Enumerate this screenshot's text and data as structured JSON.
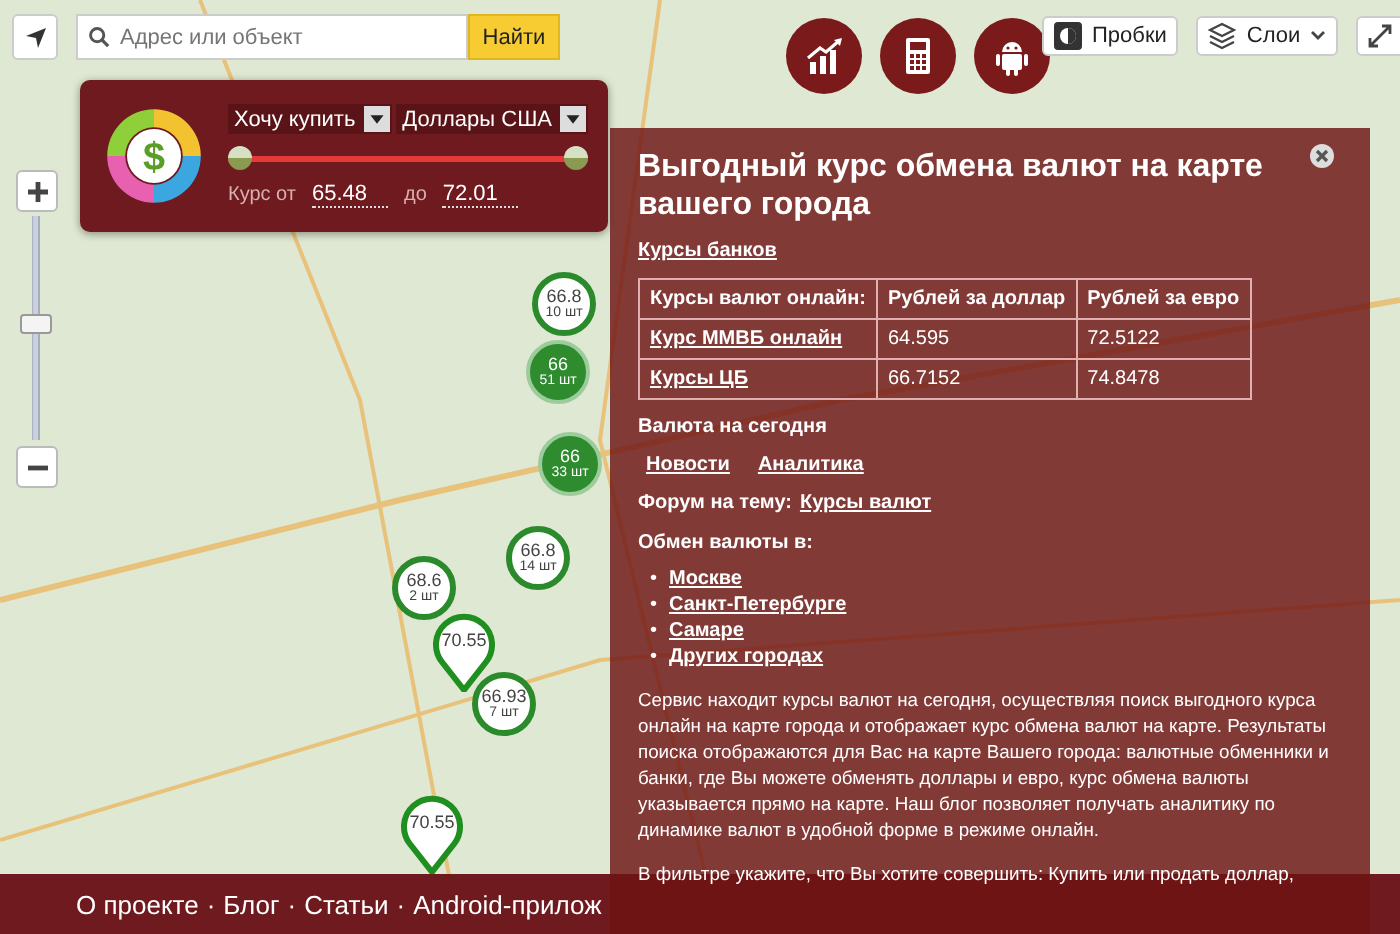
{
  "search": {
    "placeholder": "Адрес или объект",
    "button": "Найти"
  },
  "zoom": {
    "level": 0.52
  },
  "filter": {
    "logo_symbol": "$",
    "action": "Хочу купить",
    "currency": "Доллары США",
    "range_low": {
      "level": 0
    },
    "range_high": {
      "level": 1
    },
    "rate_from_label": "Курс от",
    "rate_from": "65.48",
    "rate_to_label": "до",
    "rate_to": "72.01"
  },
  "toolbar": {
    "round_buttons": [
      {
        "kind": "chart"
      },
      {
        "kind": "calculator"
      },
      {
        "kind": "android"
      }
    ],
    "traffic": "Пробки",
    "layers": "Слои"
  },
  "markers": [
    {
      "kind": "cluster-light",
      "value": "66.8",
      "count": "10 шт"
    },
    {
      "kind": "cluster-dark",
      "value": "66",
      "count": "51 шт"
    },
    {
      "kind": "cluster-dark",
      "value": "66",
      "count": "33 шт"
    },
    {
      "kind": "cluster-light",
      "value": "66.8",
      "count": "14 шт"
    },
    {
      "kind": "cluster-light",
      "value": "68.6",
      "count": "2 шт"
    },
    {
      "kind": "pin",
      "value": "70.55"
    },
    {
      "kind": "cluster-light",
      "value": "66.93",
      "count": "7 шт"
    },
    {
      "kind": "pin",
      "value": "70.55"
    }
  ],
  "info_panel": {
    "title": "Выгодный курс обмена валют на карте вашего города",
    "banks_link": "Курсы банков",
    "table": {
      "columns": [
        "Курсы валют онлайн:",
        "Рублей за доллар",
        "Рублей за евро"
      ],
      "rows": [
        {
          "cells": [
            "Курс ММВБ онлайн",
            "64.595",
            "72.5122"
          ]
        },
        {
          "cells": [
            "Курсы ЦБ",
            "66.7152",
            "74.8478"
          ]
        }
      ]
    },
    "today_heading": "Валюта на сегодня",
    "today_links": [
      "Новости",
      "Аналитика"
    ],
    "forum_label": "Форум на тему:",
    "forum_link": "Курсы валют",
    "exchange_heading": "Обмен валюты в:",
    "bullet": "•",
    "cities": [
      "Москве",
      "Санкт-Петербурге",
      "Самаре",
      "Других городах"
    ],
    "paragraphs": [
      "Сервис находит курсы валют на сегодня, осуществляя поиск выгодного курса онлайн на карте города и отображает курс обмена валют на карте. Результаты поиска отображаются для Вас на карте Вашего города: валютные обменники и банки, где Вы можете обменять доллары и евро, курс обмена валюты указывается прямо на карте. Наш блог позволяет получать аналитику по динамике валют в удобной форме в режиме онлайн.",
      "В фильтре укажите, что Вы хотите совершить: Купить или продать доллар,"
    ]
  },
  "footer": {
    "separator": "·",
    "links": [
      "О проекте",
      "Блог",
      "Статьи",
      "Android-прилож"
    ]
  }
}
